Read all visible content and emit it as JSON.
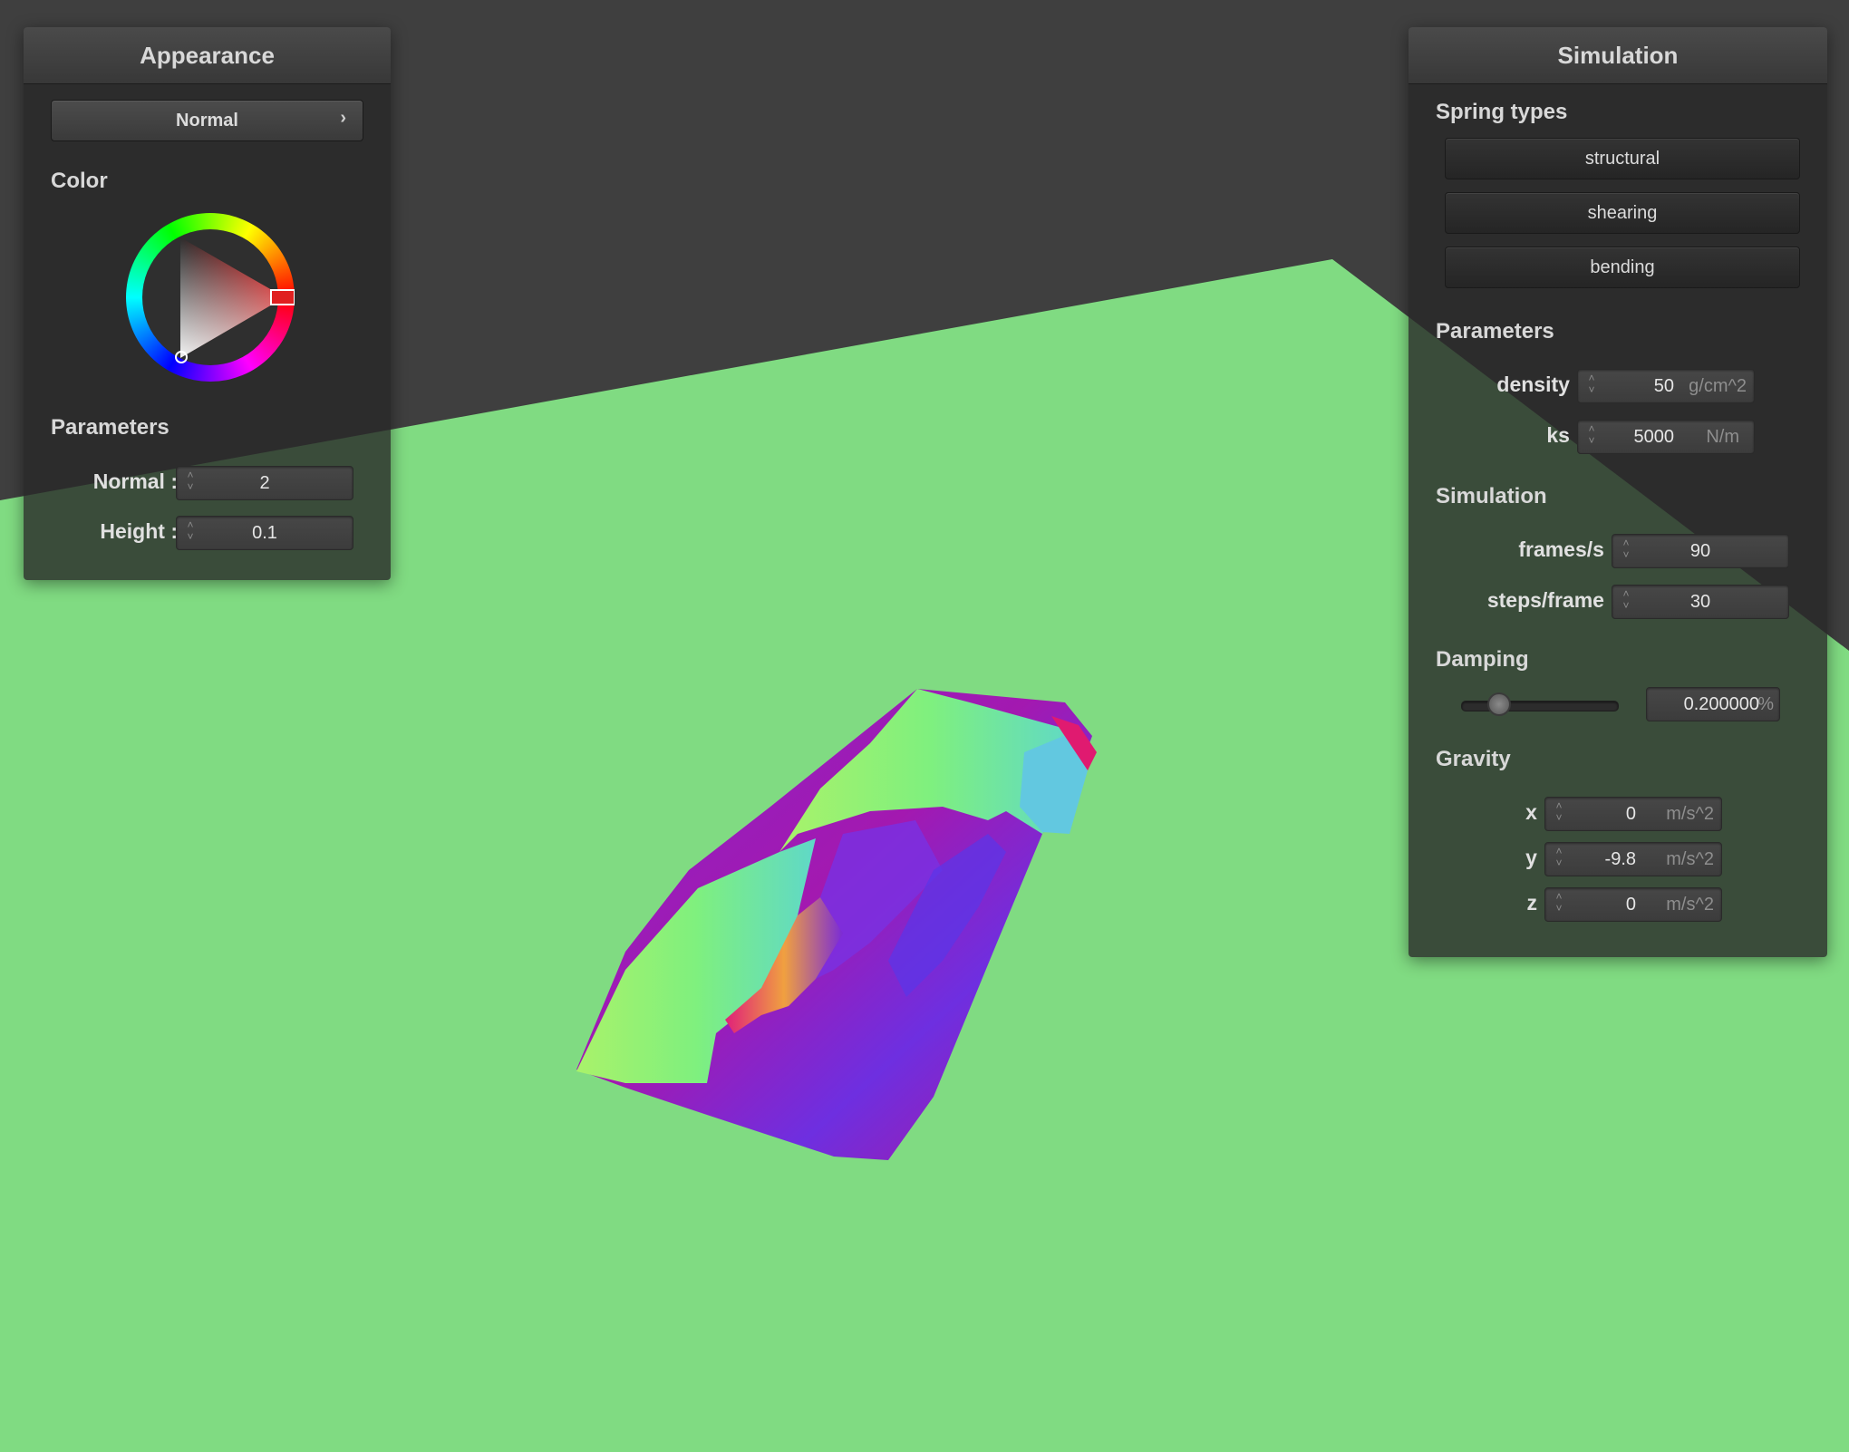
{
  "scene": {
    "background_color": "#3f3f3f",
    "ground_color": "#80db82",
    "cloth_colors": [
      "#9a1ab4",
      "#7f2bd8",
      "#9cf06a",
      "#62e3b0"
    ]
  },
  "appearance_panel": {
    "title": "Appearance",
    "shader_popup": {
      "label": "Normal",
      "chevron_icon": "chevron-right-icon"
    },
    "color_section": "Color",
    "color_wheel": {
      "selected_color": "#e02020"
    },
    "parameters_section": "Parameters",
    "fields": [
      {
        "label": "Normal :",
        "value": "2"
      },
      {
        "label": "Height :",
        "value": "0.1"
      }
    ]
  },
  "simulation_panel": {
    "title": "Simulation",
    "spring_types_section": "Spring types",
    "spring_buttons": [
      "structural",
      "shearing",
      "bending"
    ],
    "parameters_section": "Parameters",
    "parameters": [
      {
        "label": "density :",
        "value": "50",
        "unit": "g/cm^2"
      },
      {
        "label": "ks :",
        "value": "5000",
        "unit": "N/m"
      }
    ],
    "simulation_section": "Simulation",
    "simulation_fields": [
      {
        "label": "frames/s :",
        "value": "90"
      },
      {
        "label": "steps/frame :",
        "value": "30"
      }
    ],
    "damping_section": "Damping",
    "damping": {
      "value": "0.200000",
      "unit": "%",
      "slider_fraction": 0.2
    },
    "gravity_section": "Gravity",
    "gravity": [
      {
        "label": "x :",
        "value": "0",
        "unit": "m/s^2"
      },
      {
        "label": "y :",
        "value": "-9.8",
        "unit": "m/s^2"
      },
      {
        "label": "z :",
        "value": "0",
        "unit": "m/s^2"
      }
    ]
  }
}
